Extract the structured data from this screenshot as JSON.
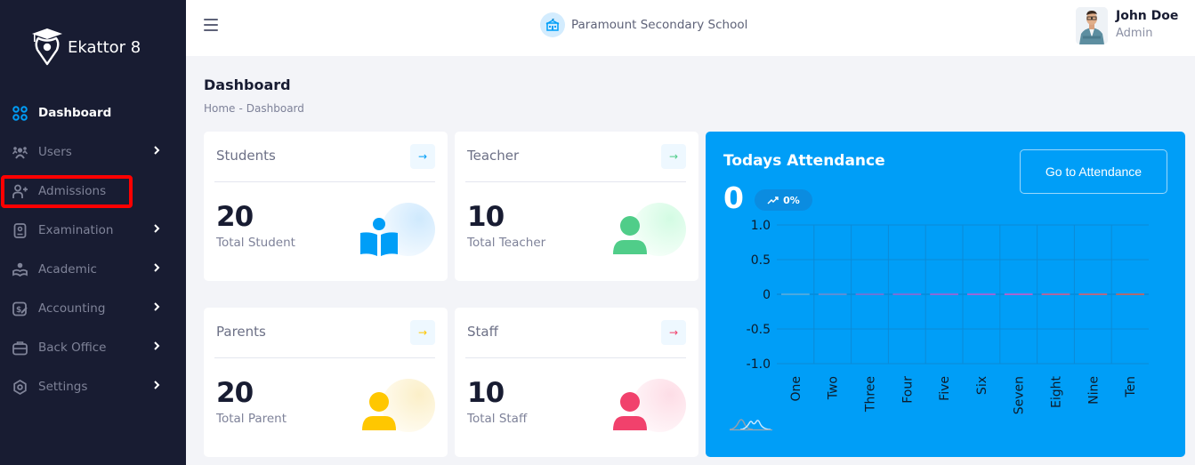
{
  "brand": {
    "name": "Ekattor 8",
    "logo_icon": "graduation-cap-pin-icon"
  },
  "sidebar": {
    "items": [
      {
        "label": "Dashboard",
        "icon": "grid-icon",
        "active": true,
        "has_submenu": false
      },
      {
        "label": "Users",
        "icon": "users-icon",
        "active": false,
        "has_submenu": true
      },
      {
        "label": "Admissions",
        "icon": "user-plus-icon",
        "active": false,
        "has_submenu": false,
        "highlighted": true
      },
      {
        "label": "Examination",
        "icon": "exam-icon",
        "active": false,
        "has_submenu": true
      },
      {
        "label": "Academic",
        "icon": "academic-icon",
        "active": false,
        "has_submenu": true
      },
      {
        "label": "Accounting",
        "icon": "accounting-icon",
        "active": false,
        "has_submenu": true
      },
      {
        "label": "Back Office",
        "icon": "briefcase-icon",
        "active": false,
        "has_submenu": true
      },
      {
        "label": "Settings",
        "icon": "gear-icon",
        "active": false,
        "has_submenu": true
      }
    ]
  },
  "header": {
    "school_name": "Paramount Secondary School",
    "user": {
      "name": "John Doe",
      "role": "Admin"
    }
  },
  "page": {
    "title": "Dashboard",
    "breadcrumb": [
      "Home",
      "-",
      "Dashboard"
    ]
  },
  "cards": [
    {
      "title": "Students",
      "value": "20",
      "subtitle": "Total Student",
      "color": "#009ef7",
      "bubble": "#d3ecfe",
      "icon": "reading-student-icon"
    },
    {
      "title": "Teacher",
      "value": "10",
      "subtitle": "Total Teacher",
      "color": "#50cd89",
      "bubble": "#d7fbe6",
      "icon": "user-icon"
    },
    {
      "title": "Parents",
      "value": "20",
      "subtitle": "Total Parent",
      "color": "#ffc700",
      "bubble": "#fbf0cc",
      "icon": "user-icon"
    },
    {
      "title": "Staff",
      "value": "10",
      "subtitle": "Total Staff",
      "color": "#f1416c",
      "bubble": "#fde1e8",
      "icon": "user-icon"
    }
  ],
  "attendance": {
    "title": "Todays Attendance",
    "value": "0",
    "badge": "0%",
    "button_label": "Go to Attendance",
    "bg_color": "#009ef7"
  },
  "chart_data": {
    "type": "bar",
    "title": "",
    "xlabel": "",
    "ylabel": "",
    "categories": [
      "One",
      "Two",
      "Three",
      "Four",
      "Five",
      "Six",
      "Seven",
      "Eight",
      "Nine",
      "Ten"
    ],
    "values": [
      0,
      0,
      0,
      0,
      0,
      0,
      0,
      0,
      0,
      0
    ],
    "bar_colors": [
      "#4aa9e0",
      "#5b8fd6",
      "#6a76d8",
      "#7a6fd8",
      "#8a6ad8",
      "#9a67d8",
      "#a865d0",
      "#b0669e",
      "#b36a85",
      "#b06a70"
    ],
    "yticks": [
      "1.0",
      "0.5",
      "0",
      "-0.5",
      "-1.0"
    ],
    "ylim": [
      -1,
      1
    ],
    "grid": true,
    "legend": "none"
  }
}
